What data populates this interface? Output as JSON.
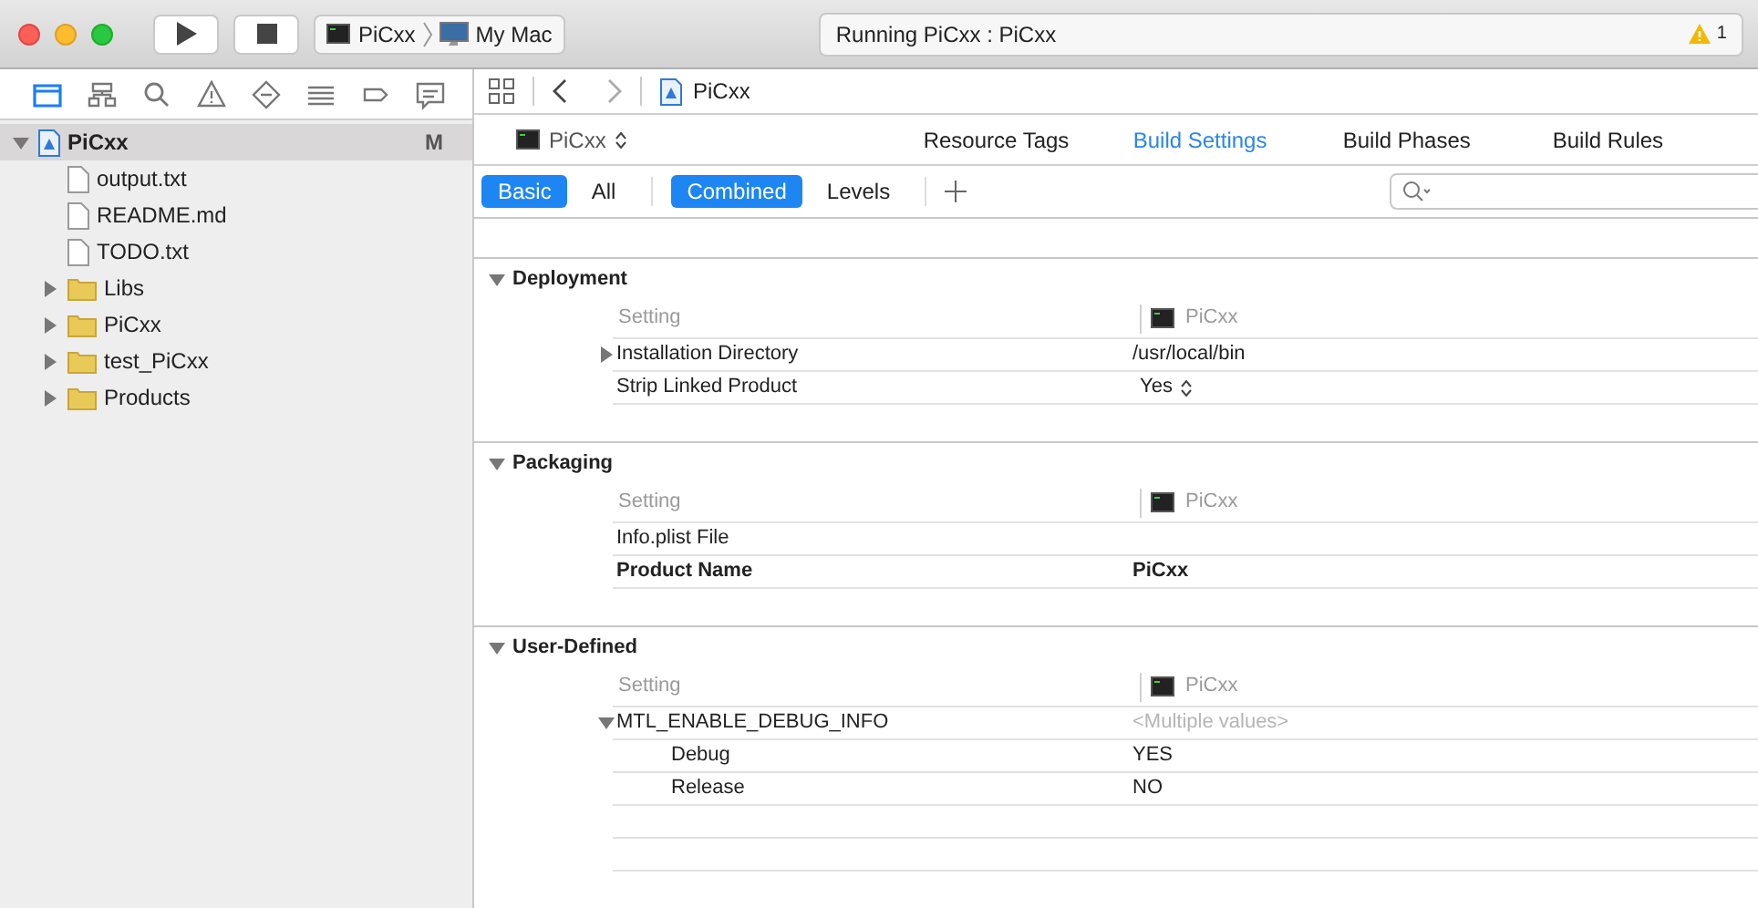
{
  "toolbar": {
    "scheme": {
      "target": "PiCxx",
      "destination": "My Mac"
    },
    "activity": {
      "status": "Running PiCxx : PiCxx",
      "warnings": "1"
    }
  },
  "navigator": {
    "tabs": [
      {
        "kind": "folder",
        "selected": true
      },
      {
        "kind": "hierarchy",
        "selected": false
      },
      {
        "kind": "search",
        "selected": false
      },
      {
        "kind": "warning",
        "selected": false
      },
      {
        "kind": "test",
        "selected": false
      },
      {
        "kind": "debug",
        "selected": false
      },
      {
        "kind": "breakpoint",
        "selected": false
      },
      {
        "kind": "report",
        "selected": false
      }
    ],
    "tree": [
      {
        "name": "PiCxx",
        "kind": "project",
        "badge": "M",
        "selected": true,
        "expanded": true,
        "children": [
          {
            "name": "output.txt",
            "kind": "file",
            "selected": false
          },
          {
            "name": "README.md",
            "kind": "file",
            "selected": false
          },
          {
            "name": "TODO.txt",
            "kind": "file",
            "selected": false
          },
          {
            "name": "Libs",
            "kind": "folder",
            "selected": false,
            "expanded": false
          },
          {
            "name": "PiCxx",
            "kind": "folder",
            "selected": false,
            "expanded": false
          },
          {
            "name": "test_PiCxx",
            "kind": "folder",
            "selected": false,
            "expanded": false
          },
          {
            "name": "Products",
            "kind": "folder",
            "selected": false,
            "expanded": false
          }
        ]
      }
    ]
  },
  "editor": {
    "jump_bar": {
      "file": "PiCxx"
    },
    "target": "PiCxx",
    "tabs": [
      {
        "label": "Resource Tags",
        "selected": false
      },
      {
        "label": "Build Settings",
        "selected": true
      },
      {
        "label": "Build Phases",
        "selected": false
      },
      {
        "label": "Build Rules",
        "selected": false
      }
    ],
    "scope_filters": [
      {
        "label": "Basic",
        "selected": true
      },
      {
        "label": "All",
        "selected": false
      }
    ],
    "view_filters": [
      {
        "label": "Combined",
        "selected": true
      },
      {
        "label": "Levels",
        "selected": false
      }
    ],
    "sections": [
      {
        "title": "Deployment",
        "column_setting": "Setting",
        "column_target": "PiCxx",
        "rows": [
          {
            "name": "Installation Directory",
            "value": "/usr/local/bin",
            "kind": "plain",
            "bold": false,
            "expanded": false
          },
          {
            "name": "Strip Linked Product",
            "value": "Yes",
            "kind": "popup",
            "bold": false
          }
        ]
      },
      {
        "title": "Packaging",
        "column_setting": "Setting",
        "column_target": "PiCxx",
        "rows": [
          {
            "name": "Info.plist File",
            "kind": "plain",
            "bold": false
          },
          {
            "name": "Product Name",
            "value": "PiCxx",
            "kind": "plain",
            "bold": true
          }
        ]
      },
      {
        "title": "User-Defined",
        "column_setting": "Setting",
        "column_target": "PiCxx",
        "rows": [
          {
            "name": "MTL_ENABLE_DEBUG_INFO",
            "value": "<Multiple values>",
            "kind": "placeholder",
            "bold": false,
            "expanded": true,
            "children": [
              {
                "name": "Debug",
                "value": "YES",
                "kind": "plain",
                "bold": false
              },
              {
                "name": "Release",
                "value": "NO",
                "kind": "plain",
                "bold": false
              }
            ]
          }
        ]
      }
    ]
  }
}
